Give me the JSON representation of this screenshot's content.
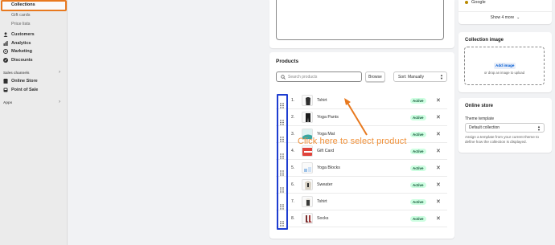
{
  "sidebar": {
    "active": "Collections",
    "subitems": [
      "Gift cards",
      "Price lists"
    ],
    "items": [
      {
        "label": "Customers",
        "icon": "person-icon"
      },
      {
        "label": "Analytics",
        "icon": "bar-chart-icon"
      },
      {
        "label": "Marketing",
        "icon": "target-icon"
      },
      {
        "label": "Discounts",
        "icon": "discount-icon"
      }
    ],
    "sales_channels_heading": "Sales channels",
    "channels": [
      {
        "label": "Online Store",
        "icon": "store-icon"
      },
      {
        "label": "Point of Sale",
        "icon": "pos-icon"
      }
    ],
    "apps_heading": "Apps"
  },
  "products": {
    "title": "Products",
    "search_placeholder": "Search products",
    "browse_label": "Browse",
    "sort_label": "Sort: Manually",
    "rows": [
      {
        "num": "1.",
        "name": "Tshirt",
        "status": "Active"
      },
      {
        "num": "2.",
        "name": "Yoga Pants",
        "status": "Active"
      },
      {
        "num": "3.",
        "name": "Yoga Mat",
        "status": "Active"
      },
      {
        "num": "4.",
        "name": "Gift Card",
        "status": "Active"
      },
      {
        "num": "5.",
        "name": "Yoga Blocks",
        "status": "Active"
      },
      {
        "num": "6.",
        "name": "Sweater",
        "status": "Active"
      },
      {
        "num": "7.",
        "name": "Tshirt",
        "status": "Active"
      },
      {
        "num": "8.",
        "name": "Socks",
        "status": "Active"
      }
    ]
  },
  "annotation": "Click here to select product",
  "right": {
    "channel": "Google",
    "show_more": "Show 4 more",
    "image_title": "Collection image",
    "add_image": "Add image",
    "drop_hint": "or drop an image to upload",
    "store_title": "Online store",
    "theme_label": "Theme template",
    "theme_value": "Default collection",
    "help_text": "Assign a template from your current theme to define how the collection is displayed."
  },
  "colors": {
    "highlight_orange": "#e8791f",
    "drag_outline_blue": "#1e3dd1",
    "annotation_orange": "#f0913a",
    "active_badge_bg": "#cdfee1"
  }
}
